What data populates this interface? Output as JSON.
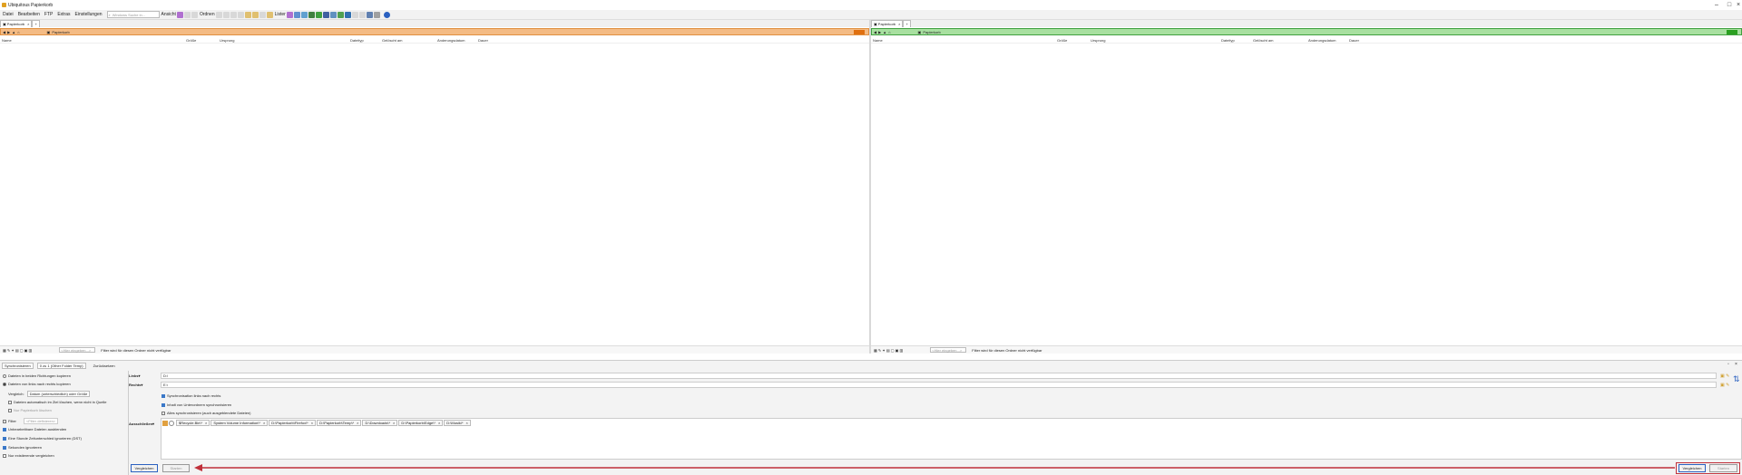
{
  "window": {
    "title": "Ubiquitous Papierkorb"
  },
  "menu": [
    "Datei",
    "Bearbeiten",
    "FTP",
    "Extras",
    "Einstellungen"
  ],
  "toolbar": {
    "search_placeholder": "Windows Suche in...",
    "ansicht": "Ansicht",
    "ordnen": "Ordnen",
    "lister": "Lister"
  },
  "colors": {
    "left_accent": "#f0b070",
    "left_dark": "#e07010",
    "right_accent": "#a8e0a0",
    "right_dark": "#2aa020",
    "arrow": "#c0303a"
  },
  "left": {
    "tab": "Papierkorb",
    "path": "Papierkorb",
    "columns": [
      "Name",
      "Größe",
      "Ursprung",
      "Dateityp",
      "Gelöscht am",
      "Änderungsdatum",
      "Dauer"
    ],
    "filter_placeholder": "<Hier eingeben...>",
    "status": "Filter wird für diesen Ordner nicht verfügbar"
  },
  "right": {
    "tab": "Papierkorb",
    "path": "Papierkorb",
    "columns": [
      "Name",
      "Größe",
      "Ursprung",
      "Dateityp",
      "Gelöscht am",
      "Änderungsdatum",
      "Dauer"
    ],
    "filter_placeholder": "<Hier eingeben...>",
    "status": "Filter wird für diesen Ordner nicht verfügbar"
  },
  "sync": {
    "mode": "Synchronisieren",
    "profile": "0 zu 1 (Other Folder Temp)",
    "reset": "Zurücksetzen",
    "opt_both": "Dateien in beiden Richtungen kopieren",
    "opt_l2r": "Dateien von links nach rechts kopieren",
    "compare_label": "Vergleich:",
    "compare_value": "Datum (unterschiedlich) oder Größe",
    "delete_dest": "Dateien automatisch im Ziel löschen, wenn nicht in Quelle",
    "recycle_only": "Nur Papierkorb löschen",
    "filter_label": "Filter",
    "filter_ph": "<Filter definieren>",
    "no_subfolders": "Unbearbeitbare Dateien ausblenden",
    "tz_ignore": "Eine Stunde Zeitunterschied ignorieren (DST)",
    "seconds_ignore": "Sekunden ignorieren",
    "only_existing": "Nur existierende vergleichen",
    "left_label": "Links",
    "left_value": "D:\\",
    "right_label": "Rechts",
    "right_value": "E:\\",
    "sync_both": "Synchronisation links nach rechts",
    "sync_sub": "Inhalt von Unterordnern synchronisieren",
    "sync_all": "Alles synchronisieren (auch ausgeblendete Dateien)",
    "exclude_label": "Ausschließen",
    "exclusions": [
      "$Recycle.Bin\\*",
      "System Volume Information\\*",
      "D:\\Papierkorb\\Firefox\\*",
      "D:\\Papierkorb\\Temp\\*",
      "D:\\Downloads\\*",
      "D:\\Papierkorb\\Edge\\*",
      "D:\\Musik\\*"
    ],
    "compare_btn": "Vergleichen",
    "sync_btn": "Starten",
    "compare_btn2": "Vergleichen",
    "sync_btn2": "Starten"
  }
}
